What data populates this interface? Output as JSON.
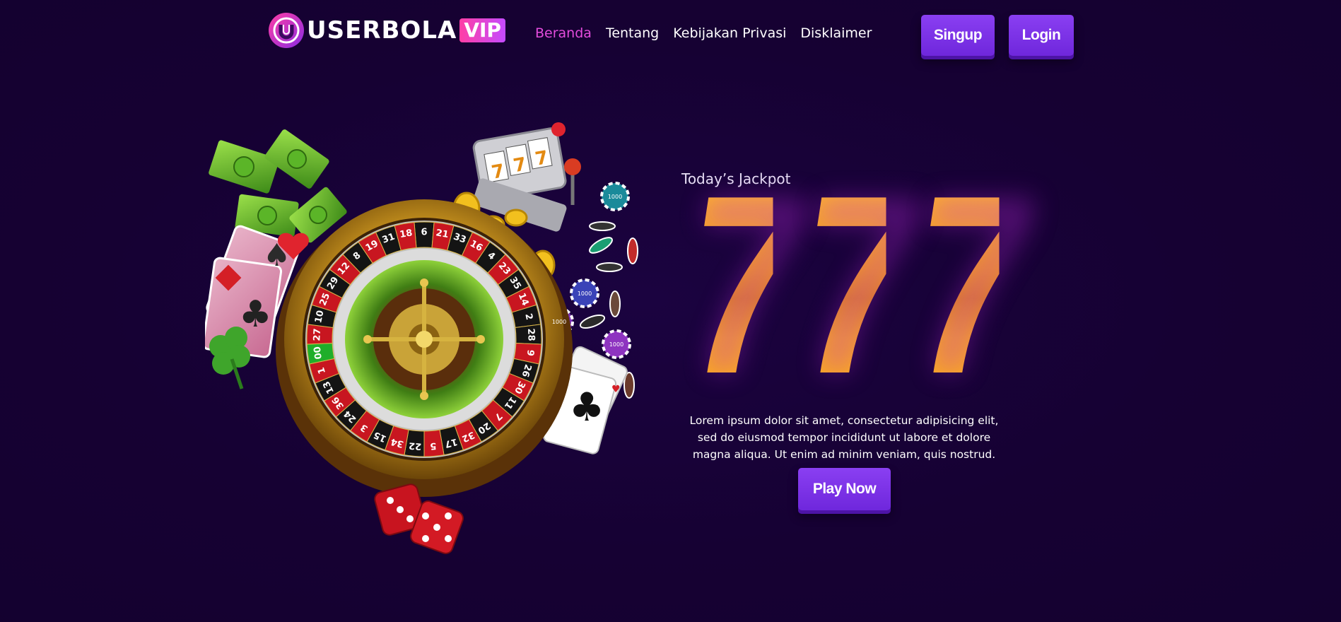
{
  "header": {
    "logo_text": "USERBOLA",
    "logo_badge": "VIP",
    "nav": [
      {
        "label": "Beranda",
        "active": true
      },
      {
        "label": "Tentang",
        "active": false
      },
      {
        "label": "Kebijakan Privasi",
        "active": false
      },
      {
        "label": "Disklaimer",
        "active": false
      }
    ],
    "signup_label": "Singup",
    "login_label": "Login"
  },
  "hero": {
    "jackpot_label": "Today’s Jackpot",
    "jackpot_digits": [
      "7",
      "7",
      "7"
    ],
    "description": "Lorem ipsum dolor sit amet, consectetur adipisicing elit, sed do eiusmod tempor incididunt ut labore et dolore magna aliqua. Ut enim ad minim veniam, quis nostrud.",
    "play_label": "Play Now",
    "art": {
      "roulette_numbers": [
        "6",
        "21",
        "33",
        "16",
        "4",
        "23",
        "35",
        "14",
        "2",
        "28",
        "9",
        "26",
        "30",
        "11",
        "7",
        "20",
        "32",
        "17",
        "5",
        "22",
        "34",
        "15",
        "3",
        "24",
        "36",
        "13",
        "1",
        "00",
        "27",
        "10",
        "25",
        "29",
        "12",
        "8",
        "19",
        "31",
        "18"
      ],
      "slot_reels": [
        "7",
        "7",
        "7"
      ],
      "chip_label": "1000"
    }
  },
  "colors": {
    "background": "#160133",
    "accent": "#8a3ff2",
    "nav_active": "#e34cdc",
    "jackpot": "#f9a71f"
  },
  "icons": [
    "logo-u-icon",
    "roulette-wheel-icon",
    "slot-machine-icon",
    "dice-icon",
    "money-icon",
    "playing-cards-icon",
    "casino-chip-icon",
    "clover-icon",
    "gold-coin-icon"
  ]
}
